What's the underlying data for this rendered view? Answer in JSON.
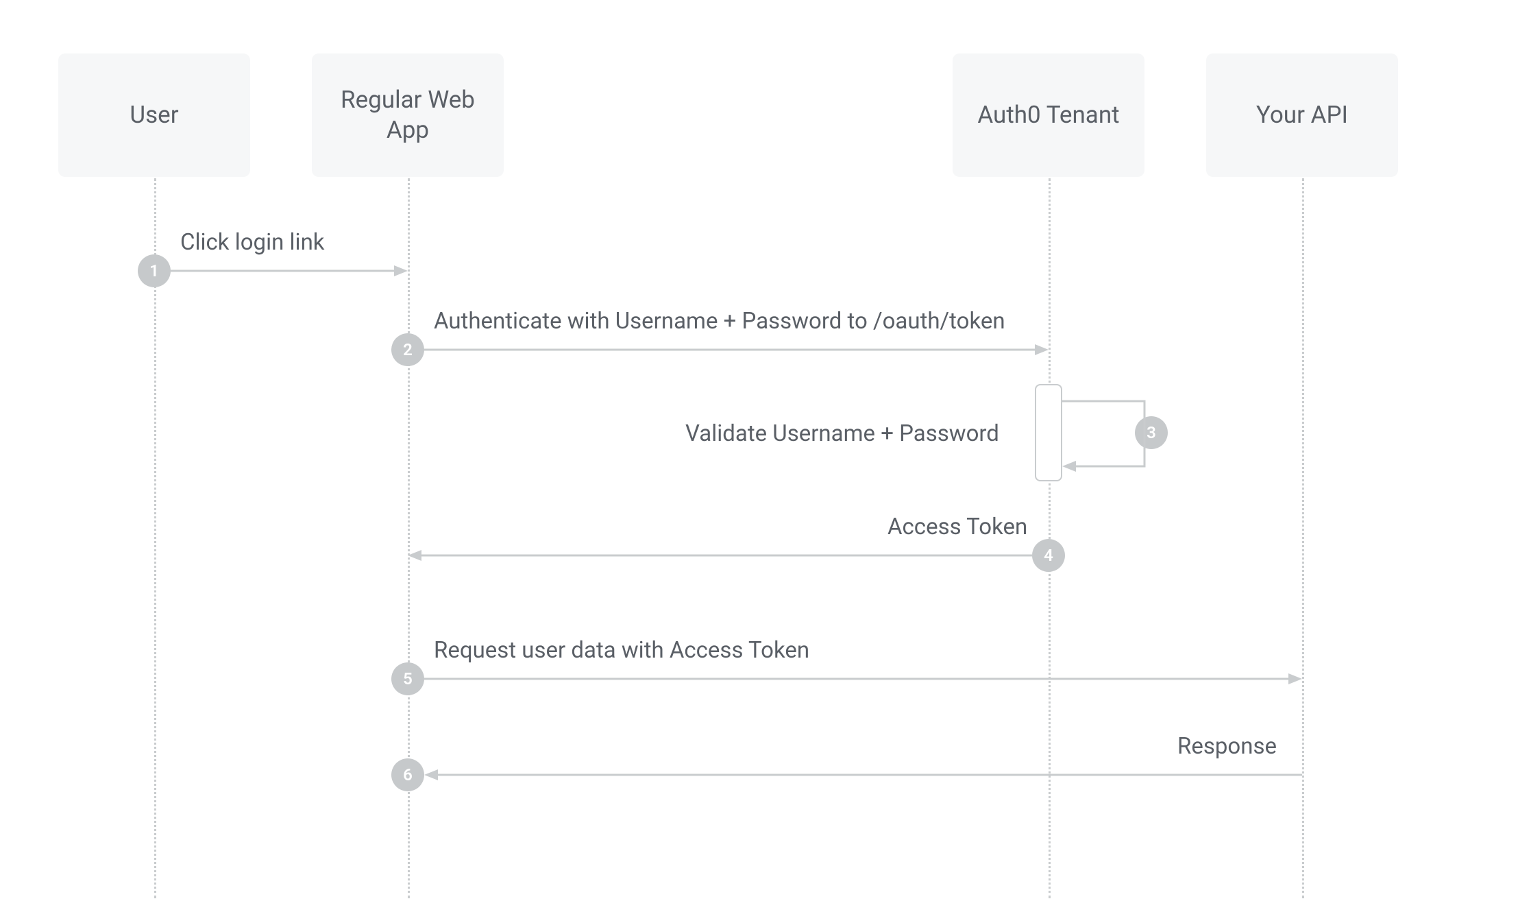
{
  "actors": {
    "user": "User",
    "webapp": "Regular Web App",
    "auth0": "Auth0 Tenant",
    "api": "Your API"
  },
  "steps": {
    "s1": {
      "num": "1",
      "label": "Click login link"
    },
    "s2": {
      "num": "2",
      "label": "Authenticate with Username + Password to /oauth/token"
    },
    "s3": {
      "num": "3",
      "label": "Validate Username + Password"
    },
    "s4": {
      "num": "4",
      "label": "Access Token"
    },
    "s5": {
      "num": "5",
      "label": "Request user data with Access Token"
    },
    "s6": {
      "num": "6",
      "label": "Response"
    }
  }
}
